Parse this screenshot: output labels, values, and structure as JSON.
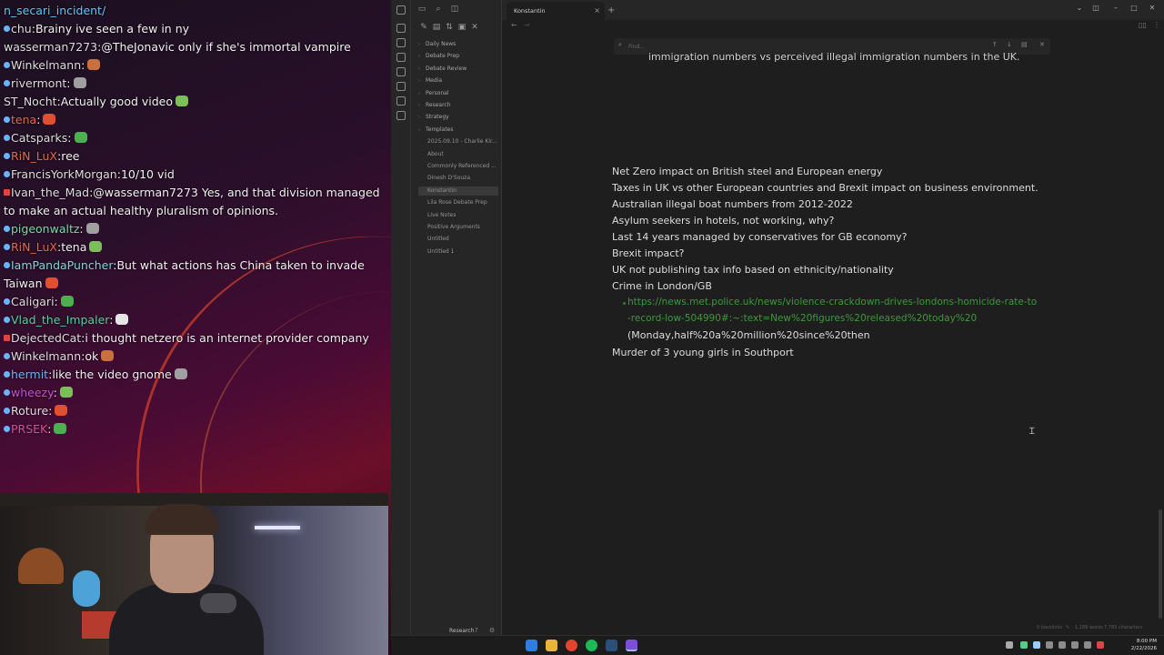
{
  "stream": {
    "chat": [
      {
        "user": "n_secari_incident/",
        "text": "",
        "color": "#5bc8ff",
        "dot": "none"
      },
      {
        "user": "chu",
        "text": "Brainy ive seen a few in ny",
        "color": "#dddddd",
        "dot": "blue"
      },
      {
        "user": "wasserman7273",
        "text": "@TheJonavic only if she's immortal vampire",
        "color": "#dddddd",
        "dot": "none"
      },
      {
        "user": "Winkelmann",
        "text": "",
        "color": "#dddddd",
        "dot": "blue"
      },
      {
        "user": "rivermont",
        "text": "",
        "color": "#dddddd",
        "dot": "blue"
      },
      {
        "user": "ST_Nocht",
        "text": "Actually good video",
        "color": "#dddddd",
        "dot": "none"
      },
      {
        "user": "tena",
        "text": "",
        "color": "#e06a4a",
        "dot": "blue"
      },
      {
        "user": "Catsparks",
        "text": "",
        "color": "#dddddd",
        "dot": "blue"
      },
      {
        "user": "RiN_LuX",
        "text": "ree",
        "color": "#e06a4a",
        "dot": "blue"
      },
      {
        "user": "FrancisYorkMorgan",
        "text": "10/10 vid",
        "color": "#dddddd",
        "dot": "blue"
      },
      {
        "user": "Ivan_the_Mad",
        "text": "@wasserman7273 Yes, and that division managed to make an actual healthy pluralism of opinions.",
        "color": "#dddddd",
        "dot": "red"
      },
      {
        "user": "pigeonwaltz",
        "text": "",
        "color": "#7fd6a8",
        "dot": "blue"
      },
      {
        "user": "RiN_LuX",
        "text": "tena",
        "color": "#e06a4a",
        "dot": "blue"
      },
      {
        "user": "IamPandaPuncher",
        "text": "But what actions has China taken to invade Taiwan",
        "color": "#7fd6d6",
        "dot": "blue"
      },
      {
        "user": "Caligari",
        "text": "",
        "color": "#dddddd",
        "dot": "blue"
      },
      {
        "user": "Vlad_the_Impaler",
        "text": "",
        "color": "#4fd6a0",
        "dot": "blue"
      },
      {
        "user": "DejectedCat",
        "text": "i thought netzero is an internet provider company",
        "color": "#dddddd",
        "dot": "red"
      },
      {
        "user": "Winkelmann",
        "text": "ok",
        "color": "#dddddd",
        "dot": "blue"
      },
      {
        "user": "hermit",
        "text": "like the video gnome",
        "color": "#6ab4ff",
        "dot": "blue"
      },
      {
        "user": "wheezy",
        "text": "",
        "color": "#c84fd8",
        "dot": "blue"
      },
      {
        "user": "Roture",
        "text": "",
        "color": "#dddddd",
        "dot": "blue"
      },
      {
        "user": "PRSEK",
        "text": "",
        "color": "#d84f9a",
        "dot": "blue"
      }
    ]
  },
  "app": {
    "tab_title": "Konstantin",
    "find_placeholder": "Find...",
    "sidebar": {
      "folders": [
        "Daily News",
        "Debate Prep",
        "Debate Review",
        "Media",
        "Personal",
        "Research",
        "Strategy",
        "Templates"
      ],
      "files": [
        "2025.09.10 - Charlie Kir...",
        "About",
        "Commonly Referenced ...",
        "Dinesh D'Souza",
        "Konstantin",
        "Lila Rose Debate Prep",
        "Live Notes",
        "Positive Arguments",
        "Untitled",
        "Untitled 1"
      ],
      "active_file": "Konstantin",
      "vault_name": "Research"
    },
    "editor": {
      "cutoff_line": "immigration numbers vs perceived illegal immigration numbers in the UK.",
      "lines": [
        "Net Zero impact on British steel and European energy",
        "Taxes in UK vs other European countries and Brexit impact on business environment.",
        "Australian illegal boat numbers from 2012-2022",
        "Asylum seekers in hotels, not working, why?",
        "Last 14 years managed by conservatives for GB economy?",
        "Brexit impact?",
        "UK not publishing tax info based on ethnicity/nationality",
        "Crime in London/GB"
      ],
      "link_line_1": "https://news.met.police.uk/news/violence-crackdown-drives-londons-homicide-rate-to",
      "link_line_2": "-record-low-504990#:~:text=New%20figures%20released%20today%20",
      "link_line_3": "(Monday,half%20a%20million%20since%20then",
      "last_line": "Murder of 3 young girls in Southport"
    },
    "status": {
      "backlinks": "0 backlinks",
      "words": "1,189 words",
      "characters": "7,783 characters"
    }
  },
  "taskbar": {
    "time": "8:00 PM",
    "date": "2/22/2026"
  }
}
